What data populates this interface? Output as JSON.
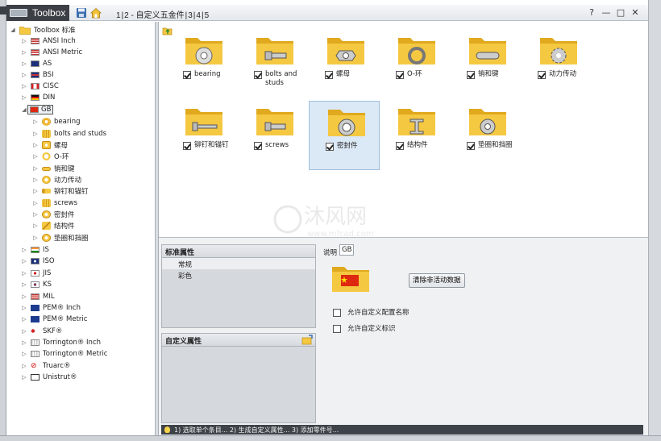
{
  "titlebar": {
    "app_title": "Toolbox",
    "crumbs": [
      "1",
      "2 - 自定义五金件",
      "3",
      "4",
      "5"
    ],
    "help_label": "?",
    "minimize_label": "—",
    "restore_label": "□",
    "close_label": "✕"
  },
  "tree": {
    "root_label": "Toolbox 标准",
    "standards": [
      {
        "label": "ANSI Inch",
        "icon": "us-flag-icon"
      },
      {
        "label": "ANSI Metric",
        "icon": "us-flag-icon"
      },
      {
        "label": "AS",
        "icon": "australia-flag-icon"
      },
      {
        "label": "BSI",
        "icon": "uk-flag-icon"
      },
      {
        "label": "CISC",
        "icon": "canada-flag-icon"
      },
      {
        "label": "DIN",
        "icon": "germany-flag-icon"
      },
      {
        "label": "GB",
        "icon": "china-flag-icon"
      }
    ],
    "gb_children": [
      "bearing",
      "bolts and studs",
      "螺母",
      "O-环",
      "销和键",
      "动力传动",
      "铆钉和锚钉",
      "screws",
      "密封件",
      "结构件",
      "垫圈和挡圈"
    ],
    "standards_after": [
      {
        "label": "IS",
        "icon": "india-flag-icon"
      },
      {
        "label": "ISO",
        "icon": "iso-icon"
      },
      {
        "label": "JIS",
        "icon": "japan-flag-icon"
      },
      {
        "label": "KS",
        "icon": "korea-flag-icon"
      },
      {
        "label": "MIL",
        "icon": "us-flag-icon"
      },
      {
        "label": "PEM® Inch",
        "icon": "pem-icon"
      },
      {
        "label": "PEM® Metric",
        "icon": "pem-icon"
      },
      {
        "label": "SKF®",
        "icon": "skf-icon"
      },
      {
        "label": "Torrington® Inch",
        "icon": "torrington-icon"
      },
      {
        "label": "Torrington® Metric",
        "icon": "torrington-icon"
      },
      {
        "label": "Truarc®",
        "icon": "truarc-icon"
      },
      {
        "label": "Unistrut®",
        "icon": "unistrut-icon"
      }
    ]
  },
  "grid": {
    "items": [
      {
        "label": "bearing",
        "icon": "bearing-icon",
        "checked": true,
        "selected": false
      },
      {
        "label": "bolts and studs",
        "icon": "bolt-icon",
        "checked": true,
        "selected": false
      },
      {
        "label": "螺母",
        "icon": "nut-icon",
        "checked": true,
        "selected": false
      },
      {
        "label": "O-环",
        "icon": "o-ring-icon",
        "checked": true,
        "selected": false
      },
      {
        "label": "销和键",
        "icon": "pin-icon",
        "checked": true,
        "selected": false
      },
      {
        "label": "动力传动",
        "icon": "gear-icon",
        "checked": true,
        "selected": false
      },
      {
        "label": "铆钉和锚钉",
        "icon": "rivet-icon",
        "checked": true,
        "selected": false
      },
      {
        "label": "screws",
        "icon": "screw-icon",
        "checked": true,
        "selected": false
      },
      {
        "label": "密封件",
        "icon": "seal-icon",
        "checked": true,
        "selected": true
      },
      {
        "label": "结构件",
        "icon": "beam-icon",
        "checked": true,
        "selected": false
      },
      {
        "label": "垫圈和挡圈",
        "icon": "washer-icon",
        "checked": true,
        "selected": false
      }
    ]
  },
  "watermark": {
    "text": "沐风网",
    "subtext": "www.mfcad.com"
  },
  "standard_props": {
    "title": "标准属性",
    "rows": [
      "常规",
      "彩色"
    ]
  },
  "custom_props": {
    "title": "自定义属性"
  },
  "props": {
    "desc_label": "说明",
    "desc_value": "GB",
    "clear_button": "清除非活动数据",
    "opt_config_name": "允许自定义配置名称",
    "opt_custom_id": "允许自定义标识",
    "opt_config_checked": false,
    "opt_id_checked": false
  },
  "status": {
    "text": "1) 选取单个条目... 2) 生成自定义属性... 3) 添加零件号..."
  },
  "colors": {
    "folder_yellow": "#f5c842",
    "folder_dark": "#e0a91e",
    "selection": "#dbe8f5",
    "status_bar": "#3e4349"
  }
}
